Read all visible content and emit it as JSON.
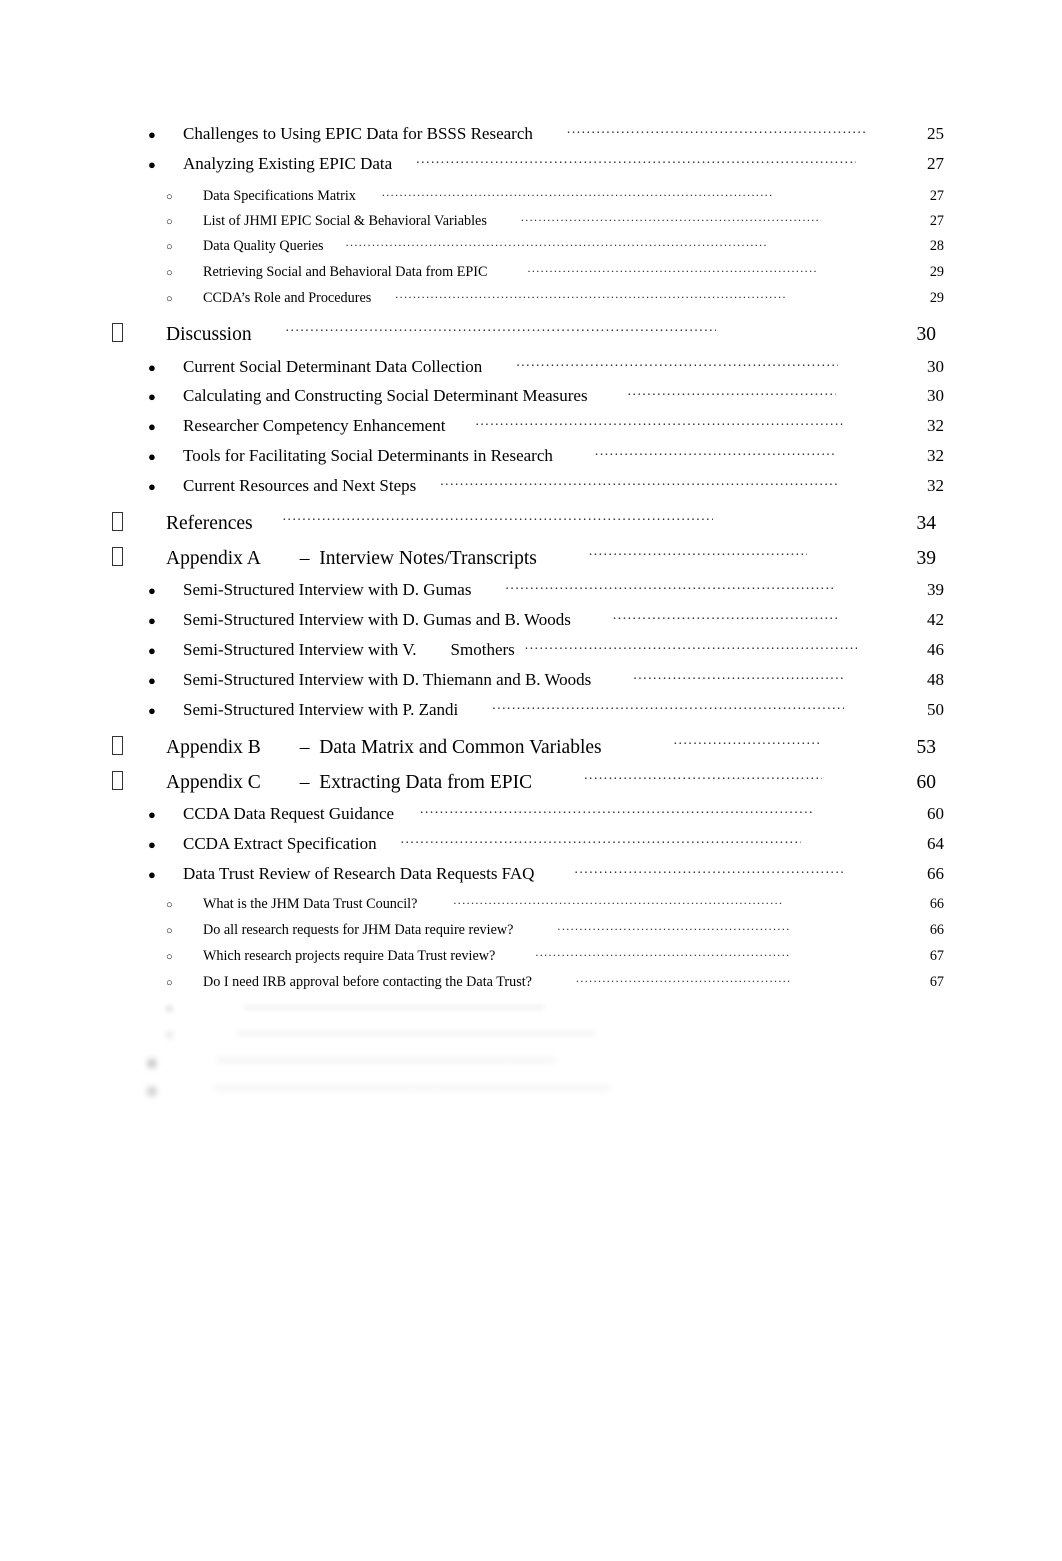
{
  "document": {
    "kind": "table-of-contents",
    "page_background": "#ffffff",
    "text_color": "#000000",
    "leader_char": "."
  },
  "bullets": {
    "level1": "tofu-box",
    "level2": "●",
    "level3": "○"
  },
  "entries": [
    {
      "level": 2,
      "label": "Challenges to Using EPIC Data for BSSS Research",
      "page": "25",
      "gap": 34,
      "leader_width": 300
    },
    {
      "level": 2,
      "label": "Analyzing Existing EPIC Data",
      "page": "27",
      "gap": 24,
      "leader_width": 440
    },
    {
      "level": 3,
      "label": "Data Specifications Matrix",
      "page": "27",
      "gap": 26,
      "leader_width": 390
    },
    {
      "level": 3,
      "label": "List of JHMI EPIC Social & Behavioral Variables",
      "page": "27",
      "gap": 34,
      "leader_width": 300
    },
    {
      "level": 3,
      "label": "Data Quality Queries",
      "page": "28",
      "gap": 22,
      "leader_width": 420
    },
    {
      "level": 3,
      "label": "Retrieving Social and Behavioral Data from EPIC",
      "page": "29",
      "gap": 40,
      "leader_width": 290
    },
    {
      "level": 3,
      "label": "CCDA’s Role and Procedures",
      "page": "29",
      "gap": 24,
      "leader_width": 390
    },
    {
      "level": 1,
      "label": "Discussion",
      "page": "30",
      "gap": 34,
      "leader_width": 430
    },
    {
      "level": 2,
      "label": "Current Social Determinant Data Collection",
      "page": "30",
      "gap": 34,
      "leader_width": 322
    },
    {
      "level": 2,
      "label": "Calculating and Constructing Social Determinant Measures",
      "page": "30",
      "gap": 40,
      "leader_width": 208
    },
    {
      "level": 2,
      "label": "Researcher Competency Enhancement",
      "page": "32",
      "gap": 30,
      "leader_width": 370
    },
    {
      "level": 2,
      "label": "Tools for Facilitating Social Determinants in Research",
      "page": "32",
      "gap": 42,
      "leader_width": 240
    },
    {
      "level": 2,
      "label": "Current Resources and Next Steps",
      "page": "32",
      "gap": 24,
      "leader_width": 400
    },
    {
      "level": 1,
      "label": "References",
      "page": "34",
      "gap": 30,
      "leader_width": 430
    },
    {
      "level": 1,
      "label": "Appendix A  –  Interview Notes/Transcripts",
      "page": "39",
      "gap": 52,
      "leader_width": 218
    },
    {
      "level": 2,
      "label": "Semi-Structured Interview with D. Gumas",
      "page": "39",
      "gap": 34,
      "leader_width": 328
    },
    {
      "level": 2,
      "label": "Semi-Structured Interview with D. Gumas and B. Woods",
      "page": "42",
      "gap": 42,
      "leader_width": 226
    },
    {
      "level": 2,
      "label": "Semi-Structured Interview with V.  Smothers",
      "page": "46",
      "gap": 10,
      "leader_width": 332
    },
    {
      "level": 2,
      "label": "Semi-Structured Interview with D. Thiemann and B. Woods",
      "page": "48",
      "gap": 42,
      "leader_width": 210
    },
    {
      "level": 2,
      "label": "Semi-Structured Interview with P. Zandi",
      "page": "50",
      "gap": 34,
      "leader_width": 352
    },
    {
      "level": 1,
      "label": "Appendix B  –  Data Matrix and Common Variables",
      "page": "53",
      "gap": 72,
      "leader_width": 148
    },
    {
      "level": 1,
      "label": "Appendix C  –  Extracting Data from EPIC",
      "page": "60",
      "gap": 52,
      "leader_width": 238
    },
    {
      "level": 2,
      "label": "CCDA Data Request Guidance",
      "page": "60",
      "gap": 26,
      "leader_width": 392
    },
    {
      "level": 2,
      "label": "CCDA Extract Specification",
      "page": "64",
      "gap": 24,
      "leader_width": 400
    },
    {
      "level": 2,
      "label": "Data Trust Review of Research Data Requests FAQ",
      "page": "66",
      "gap": 40,
      "leader_width": 272
    },
    {
      "level": 3,
      "label": "What is the JHM Data Trust Council?",
      "page": "66",
      "gap": 36,
      "leader_width": 330
    },
    {
      "level": 3,
      "label": "Do all research requests for JHM Data require review?",
      "page": "66",
      "gap": 44,
      "leader_width": 232
    },
    {
      "level": 3,
      "label": "Which research projects require Data Trust review?",
      "page": "67",
      "gap": 40,
      "leader_width": 256
    },
    {
      "level": 3,
      "label": "Do I need IRB approval before contacting the Data Trust?",
      "page": "67",
      "gap": 44,
      "leader_width": 216
    },
    {
      "level": 3,
      "label": " ",
      "page": " ",
      "gap": 38,
      "leader_width": 300,
      "blur": 1
    },
    {
      "level": 3,
      "label": " ",
      "page": " ",
      "gap": 30,
      "leader_width": 360,
      "blur": 2
    },
    {
      "level": 2,
      "label": " ",
      "page": " ",
      "gap": 30,
      "leader_width": 340,
      "blur": 3
    },
    {
      "level": 2,
      "label": " ",
      "page": " ",
      "gap": 26,
      "leader_width": 400,
      "blur": 4
    }
  ]
}
